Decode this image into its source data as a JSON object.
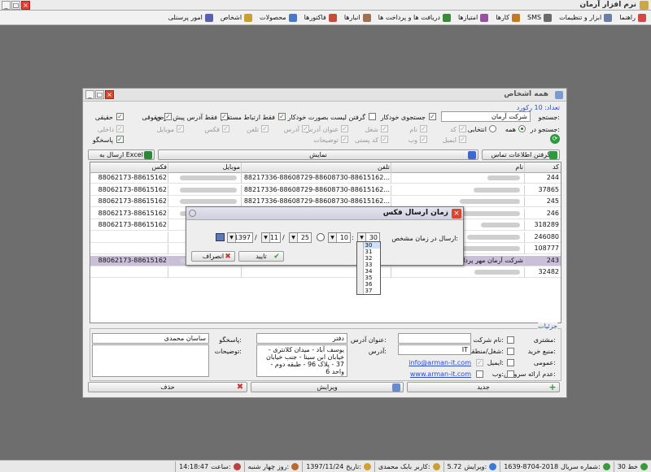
{
  "app": {
    "title": "نرم افزار آرمان"
  },
  "menu": [
    "راهنما",
    "ابزار و تنظیمات",
    "SMS",
    "کارها",
    "امتیازها",
    "دریافت ها و پرداخت ها",
    "انبارها",
    "فاکتورها",
    "محصولات",
    "اشخاص",
    "امور پرسنلی"
  ],
  "menu_icon_colors": [
    "#d04848",
    "#6a7fa8",
    "#6b6b6b",
    "#c27a26",
    "#9a50a0",
    "#3a8a3a",
    "#a07050",
    "#c84a3a",
    "#4a78c8",
    "#c8a030",
    "#5a60b0"
  ],
  "status": {
    "line": "خط 30",
    "serial_label": "شماره سریال:",
    "serial": "1639-8704-2018",
    "version_label": "ویرایش:",
    "version": "5.72",
    "user_label": "کاربر:",
    "user": "بابک محمدی",
    "date_label": "تاریخ:",
    "date": "1397/11/24",
    "day_label": "روز:",
    "day": "چهار شنبه",
    "time_label": "ساعت:",
    "time": "14:18:47"
  },
  "people": {
    "title": "همه اشخاص",
    "count_label": "تعداد: 10 رکورد",
    "search_label": "جستجو:",
    "search_value": "شرکت آرمان",
    "auto_search": "جستجوی خودکار",
    "auto_list": "گرفتن لیست بصورت خودکار",
    "direct_only": "فقط ارتباط مستقیم",
    "default_addr_only": "فقط آدرس پیش فرض",
    "search_in_label": "جستجو در:",
    "all": "همه",
    "selective": "انتخابی",
    "fields_row1": [
      "کد",
      "نام",
      "شغل",
      "عنوان آدرس",
      "آدرس",
      "تلفن",
      "فکس",
      "موبایل",
      "داخلی"
    ],
    "fields_row2": [
      "ایمیل",
      "وب",
      "کد پستی",
      "توضیحات"
    ],
    "type_legal": "حقوقی",
    "type_real": "حقیقی",
    "type_resp": "پاسخگو",
    "get_contacts": "گرفتن اطلاعات تماس",
    "show": "نمایش",
    "excel": "ارسال به Excel",
    "columns": {
      "code": "کد",
      "name": "نام",
      "phone": "تلفن",
      "mobile": "موبایل",
      "fax": "فکس"
    },
    "rows": [
      {
        "code": "244",
        "name": "",
        "phone": "88217336-88608729-88608730-88615162...",
        "mobile": "",
        "fax": "88062173-88615162"
      },
      {
        "code": "37865",
        "name": "",
        "phone": "88217336-88608729-88608730-88615162...",
        "mobile": "",
        "fax": "88062173-88615162"
      },
      {
        "code": "245",
        "name": "",
        "phone": "88217336-88608729-88608730-88615162...",
        "mobile": "",
        "fax": "88062173-88615162"
      },
      {
        "code": "246",
        "name": "",
        "phone": "88217336-88608729-88608730-88615162...",
        "mobile": "",
        "fax": "88062173-88615162"
      },
      {
        "code": "318289",
        "name": "",
        "phone": "",
        "mobile": "",
        "fax": "88062173-88615162"
      },
      {
        "code": "246080",
        "name": "",
        "phone": "",
        "mobile": "",
        "fax": ""
      },
      {
        "code": "108777",
        "name": "",
        "phone": "",
        "mobile": "",
        "fax": ""
      },
      {
        "code": "243",
        "name": "شرکت آرمان مهر پرداز فردا (سهامی خاص)",
        "phone": "88217336-88608729-88608730-88615162...",
        "mobile": "",
        "fax": "88062173-88615162"
      },
      {
        "code": "32482",
        "name": "",
        "phone": "",
        "mobile": "",
        "fax": ""
      }
    ],
    "details": {
      "title": "جزئیات",
      "customer": "مشتری:",
      "company_name": "نام شرکت:",
      "job_label": "شغل/منطقت:",
      "job": "IT",
      "source_label": "منبع خرید:",
      "public_label": "عمومی:",
      "email_label": "ایمیل:",
      "email": "info@arman-it.com",
      "web_label": "وب:",
      "web": "www.arman-it.com",
      "no_service": "عدم ارائه سرویس:",
      "addr_title_label": "عنوان آدرس:",
      "addr_title": "دفتر",
      "address_label": "آدرس:",
      "address": "یوسف آباد - میدان کلانتری - خیابان ابن سینا - جنب خیابان 37 - پلاک 96 - طبقه دوم - واحد 6",
      "resp_label": "پاسخگو:",
      "resp": "ساسان محمدی",
      "notes_label": "توضیحات:"
    },
    "new": "جدید",
    "edit": "ویرایش",
    "delete": "حذف"
  },
  "fax": {
    "title": "زمان ارسال فکس",
    "send_label": "ارسال در زمان مشخص:",
    "minute": "30",
    "hour": "10",
    "day": "25",
    "month": "11",
    "year": "1397",
    "ok": "تایید",
    "cancel": "انصراف",
    "options": [
      "30",
      "31",
      "32",
      "33",
      "34",
      "35",
      "36",
      "37"
    ]
  }
}
